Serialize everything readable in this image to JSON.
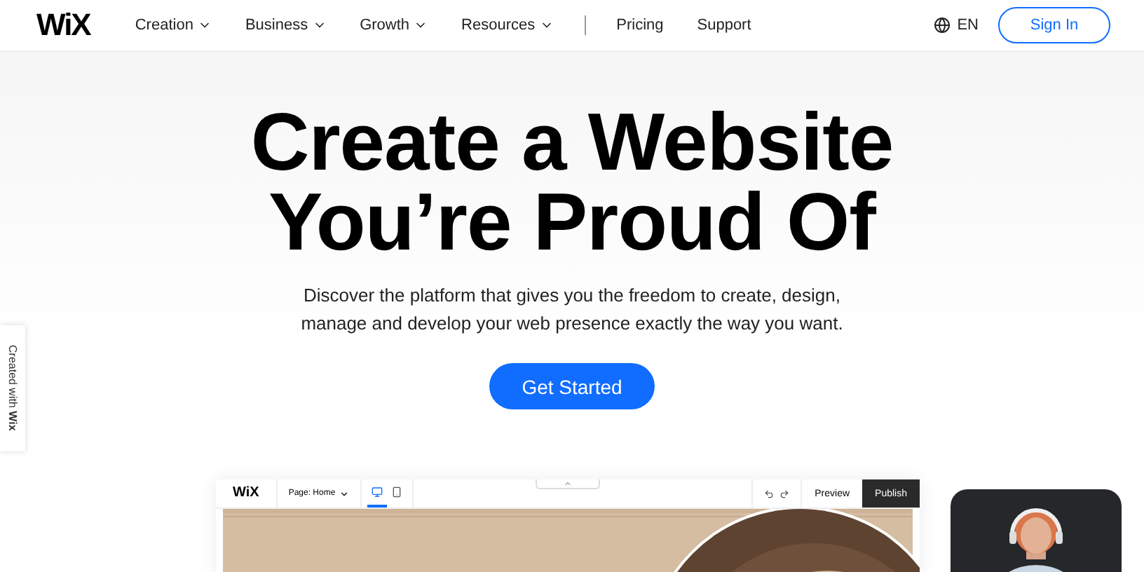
{
  "nav": {
    "logo": "WiX",
    "menu": [
      {
        "label": "Creation",
        "dropdown": true
      },
      {
        "label": "Business",
        "dropdown": true
      },
      {
        "label": "Growth",
        "dropdown": true
      },
      {
        "label": "Resources",
        "dropdown": true
      },
      {
        "label": "Pricing",
        "dropdown": false
      },
      {
        "label": "Support",
        "dropdown": false
      }
    ],
    "language": "EN",
    "sign_in": "Sign In"
  },
  "hero": {
    "title_lines": [
      "Create a Website",
      "You’re Proud Of"
    ],
    "subtitle": "Discover the platform that gives you the freedom to create, design, manage and develop your web presence exactly the way you want.",
    "cta": "Get Started"
  },
  "side_badge": "Created with **Wix**",
  "editor": {
    "logo": "WiX",
    "page_select": "Page: Home",
    "devices": [
      {
        "kind": "desktop",
        "selected": true
      },
      {
        "kind": "mobile",
        "selected": false
      }
    ],
    "preview": "Preview",
    "publish": "Publish"
  }
}
